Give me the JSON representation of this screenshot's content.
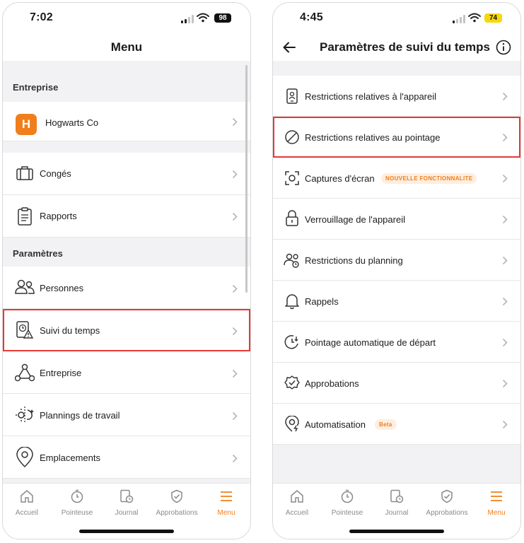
{
  "left": {
    "status": {
      "time": "7:02",
      "battery": "98"
    },
    "title": "Menu",
    "section_company": "Entreprise",
    "company_name": "Hogwarts Co",
    "company_initial": "H",
    "items_top": [
      "Congés",
      "Rapports"
    ],
    "section_settings": "Paramètres",
    "items_settings": [
      "Personnes",
      "Suivi du temps",
      "Entreprise",
      "Plannings de travail",
      "Emplacements"
    ]
  },
  "right": {
    "status": {
      "time": "4:45",
      "battery": "74"
    },
    "title": "Paramètres de suivi du temps",
    "items": [
      {
        "label": "Restrictions relatives à l'appareil",
        "icon": "phone-user-icon"
      },
      {
        "label": "Restrictions relatives au pointage",
        "icon": "no-entry-icon"
      },
      {
        "label": "Captures d'écran",
        "icon": "screenshot-icon",
        "badge": "NOUVELLE FONCTIONNALITE"
      },
      {
        "label": "Verrouillage de l'appareil",
        "icon": "lock-icon"
      },
      {
        "label": "Restrictions du planning",
        "icon": "people-icon"
      },
      {
        "label": "Rappels",
        "icon": "bell-icon"
      },
      {
        "label": "Pointage automatique de départ",
        "icon": "auto-clock-icon"
      },
      {
        "label": "Approbations",
        "icon": "verified-badge-icon"
      },
      {
        "label": "Automatisation",
        "icon": "automation-icon",
        "badge": "Beta"
      }
    ]
  },
  "tabs": [
    "Accueil",
    "Pointeuse",
    "Journal",
    "Approbations",
    "Menu"
  ],
  "colors": {
    "accent": "#f07e1a",
    "highlight": "#e53935",
    "battery_charging": "#f5d90a"
  }
}
